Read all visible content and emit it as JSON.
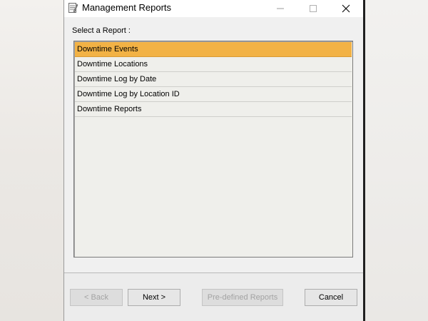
{
  "window": {
    "title": "Management Reports"
  },
  "main": {
    "select_label": "Select a Report :",
    "reports": [
      {
        "label": "Downtime Events",
        "selected": true
      },
      {
        "label": "Downtime Locations",
        "selected": false
      },
      {
        "label": "Downtime Log by Date",
        "selected": false
      },
      {
        "label": "Downtime Log by Location ID",
        "selected": false
      },
      {
        "label": "Downtime Reports",
        "selected": false
      }
    ]
  },
  "buttons": {
    "back": "< Back",
    "next": "Next >",
    "predefined": "Pre-defined Reports",
    "cancel": "Cancel"
  },
  "colors": {
    "selection": "#f2b245",
    "list_background": "#efefeb",
    "window_background": "#f0f0f0"
  },
  "icons": {
    "app": "notepad-icon",
    "minimize": "minimize-icon",
    "maximize": "maximize-icon",
    "close": "close-icon"
  }
}
